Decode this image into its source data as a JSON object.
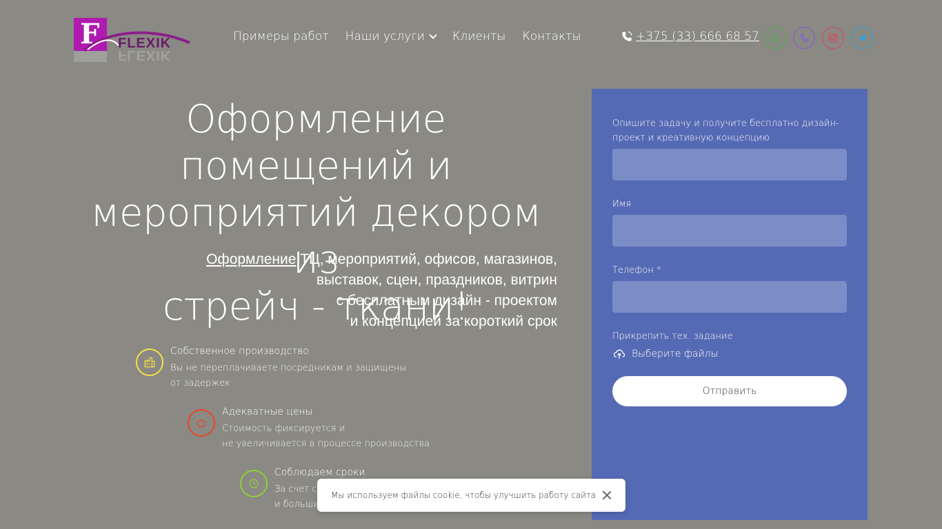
{
  "brand": {
    "name": "FLEXIK",
    "letter": "F"
  },
  "nav": [
    {
      "label": "Примеры работ"
    },
    {
      "label": "Наши услуги"
    },
    {
      "label": "Клиенты"
    },
    {
      "label": "Контакты"
    }
  ],
  "phone": "+375 (33) 666 68 57",
  "socials": [
    {
      "name": "whatsapp",
      "color": "#4caf50"
    },
    {
      "name": "viber",
      "color": "#7e5fd8"
    },
    {
      "name": "instagram",
      "color": "#e0445c"
    },
    {
      "name": "telegram",
      "color": "#2ea3dd"
    }
  ],
  "hero": {
    "title_line1": "Оформление помещений и",
    "title_line2": "мероприятий декором из",
    "title_line3": "стрейч - ткани!",
    "sub_link": "Оформление",
    "sub_line1_rest": " ТЦ, мероприятий, офисов, магазинов,",
    "sub_line2": "выставок, сцен, праздников, витрин",
    "sub_line3": "с бесплатным дизайн - проектом",
    "sub_line4": "и концепцией за короткий срок"
  },
  "features": [
    {
      "title": "Собственное производство",
      "desc1": "Вы не переплачиваете посредникам и защищены",
      "desc2": "от задержек",
      "color": "#f5e04a",
      "icon": "factory-icon"
    },
    {
      "title": "Адекватные цены",
      "desc1": "Стоимость фиксируется и",
      "desc2": "не увеличивается в процессе производства",
      "color": "#e8452c",
      "icon": "piggy-bank-icon"
    },
    {
      "title": "Соблюдаем сроки",
      "desc1": "За счет с",
      "desc2": "и больши",
      "color": "#8fcf3a",
      "icon": "clock-icon"
    }
  ],
  "form": {
    "task_label": "Опишите задачу и получите бесплатно дизайн-проект и креативную концепцию",
    "name_label": "Имя",
    "phone_label": "Телефон *",
    "attach_label": "Прикрепить тех. задание",
    "choose_files": "Выберите файлы",
    "submit": "Отправить"
  },
  "cookie": {
    "text": "Мы используем файлы cookie, чтобы улучшить работу сайта"
  }
}
